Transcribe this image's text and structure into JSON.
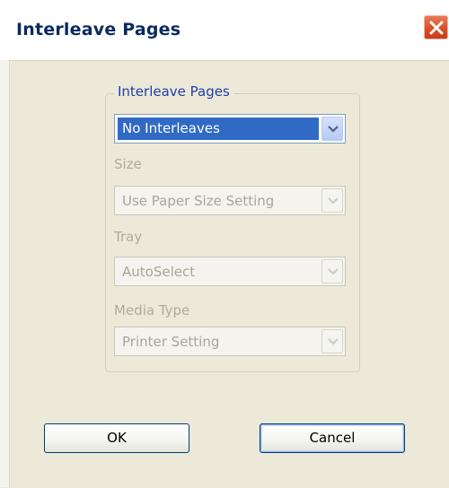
{
  "window": {
    "title": "Interleave Pages"
  },
  "group": {
    "legend": "Interleave Pages",
    "interleave_select": {
      "value": "No Interleaves"
    },
    "size": {
      "label": "Size",
      "value": "Use Paper Size Setting"
    },
    "tray": {
      "label": "Tray",
      "value": "AutoSelect"
    },
    "media_type": {
      "label": "Media Type",
      "value": "Printer Setting"
    }
  },
  "buttons": {
    "ok": "OK",
    "cancel": "Cancel"
  },
  "colors": {
    "dialog_bg": "#ece9d8",
    "title_text": "#0a2a5f",
    "legend_text": "#1f3ea6",
    "selection": "#316ac5",
    "disabled_text": "#acac9f",
    "close_button": "#d9502a"
  },
  "icons": {
    "close": "close-icon",
    "dropdown": "chevron-down-icon"
  }
}
